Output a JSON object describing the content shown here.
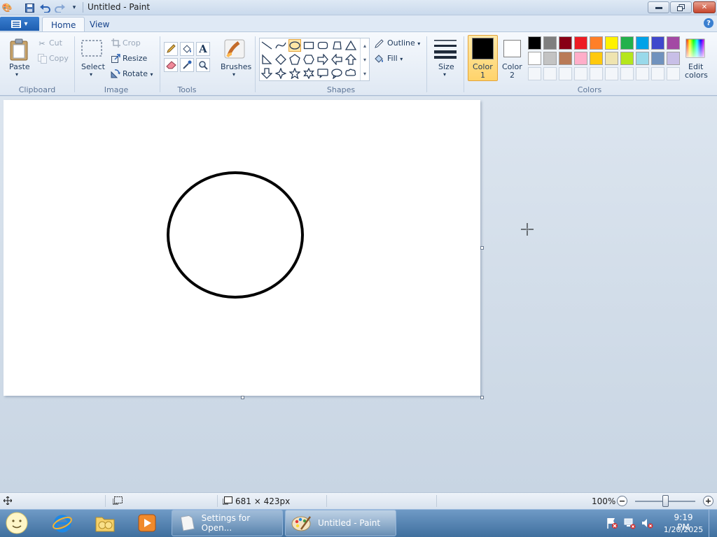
{
  "window": {
    "title": "Untitled - Paint"
  },
  "tabs": [
    {
      "label": "Home"
    },
    {
      "label": "View"
    }
  ],
  "clipboard": {
    "paste": "Paste",
    "cut": "Cut",
    "copy": "Copy",
    "group": "Clipboard"
  },
  "image": {
    "select": "Select",
    "crop": "Crop",
    "resize": "Resize",
    "rotate": "Rotate",
    "group": "Image"
  },
  "tools": {
    "group": "Tools"
  },
  "brushes": {
    "label": "Brushes"
  },
  "shapes": {
    "outline": "Outline",
    "fill": "Fill",
    "group": "Shapes"
  },
  "size": {
    "label": "Size"
  },
  "color1": {
    "line1": "Color",
    "line2": "1",
    "value": "#000000"
  },
  "color2": {
    "line1": "Color",
    "line2": "2",
    "value": "#ffffff"
  },
  "colors": {
    "group": "Colors",
    "edit_line1": "Edit",
    "edit_line2": "colors",
    "row1": [
      "#000000",
      "#7f7f7f",
      "#880015",
      "#ed1c24",
      "#ff7f27",
      "#fff200",
      "#22b14c",
      "#00a2e8",
      "#3f48cc",
      "#a349a4"
    ],
    "row2": [
      "#ffffff",
      "#c3c3c3",
      "#b97a57",
      "#ffaec9",
      "#ffc90e",
      "#efe4b0",
      "#b5e61d",
      "#99d9ea",
      "#7092be",
      "#c8bfe7"
    ]
  },
  "status": {
    "image_size": "681 × 423px",
    "zoom": "100%"
  },
  "taskbar": {
    "task1": "Settings for Open...",
    "task2": "Untitled - Paint",
    "time": "9:19 PM",
    "date": "1/20/2025"
  }
}
